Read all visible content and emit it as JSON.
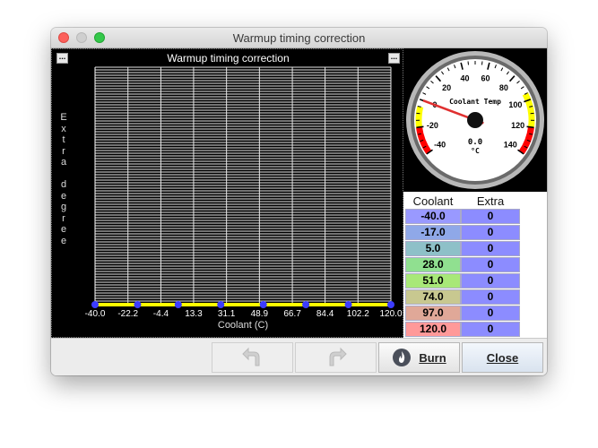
{
  "window": {
    "title": "Warmup timing correction"
  },
  "chart": {
    "title": "Warmup timing correction",
    "ylabel": "Extra degree",
    "mini_button_label": "..."
  },
  "chart_data": {
    "type": "line",
    "title": "Warmup timing correction",
    "xlabel": "Coolant (C)",
    "ylabel": "Extra degree",
    "x_ticks": [
      "-40.0",
      "-22.2",
      "-4.4",
      "13.3",
      "31.1",
      "48.9",
      "66.7",
      "84.4",
      "102.2",
      "120.0"
    ],
    "xlim": [
      -40,
      120
    ],
    "series": [
      {
        "x": [
          -40,
          -17,
          5,
          28,
          51,
          74,
          97,
          120
        ],
        "y": [
          0,
          0,
          0,
          0,
          0,
          0,
          0,
          0
        ],
        "color": "#ffff00",
        "point_color": "#3c3cff"
      }
    ],
    "grid": true
  },
  "gauge": {
    "title": "Coolant Temp",
    "value": "0.0",
    "unit": "°C",
    "min": -40,
    "max": 140,
    "ticks": [
      "-40",
      "-20",
      "0",
      "20",
      "40",
      "60",
      "80",
      "100",
      "120",
      "140"
    ],
    "needle_value": 0,
    "colors": {
      "warn": "#ffff00",
      "danger": "#ff0000",
      "needle": "#e03030"
    }
  },
  "table": {
    "headers": [
      "Coolant",
      "Extra"
    ],
    "rows": [
      {
        "coolant": "-40.0",
        "extra": "0",
        "color": "#9999ff"
      },
      {
        "coolant": "-17.0",
        "extra": "0",
        "color": "#8fa8e8"
      },
      {
        "coolant": "5.0",
        "extra": "0",
        "color": "#8ec0c8"
      },
      {
        "coolant": "28.0",
        "extra": "0",
        "color": "#90e090"
      },
      {
        "coolant": "51.0",
        "extra": "0",
        "color": "#a8e878"
      },
      {
        "coolant": "74.0",
        "extra": "0",
        "color": "#c8c890"
      },
      {
        "coolant": "97.0",
        "extra": "0",
        "color": "#e0a898"
      },
      {
        "coolant": "120.0",
        "extra": "0",
        "color": "#ff9999"
      }
    ],
    "extra_color": "#8c8cff"
  },
  "buttons": {
    "burn": "Burn",
    "close": "Close"
  }
}
